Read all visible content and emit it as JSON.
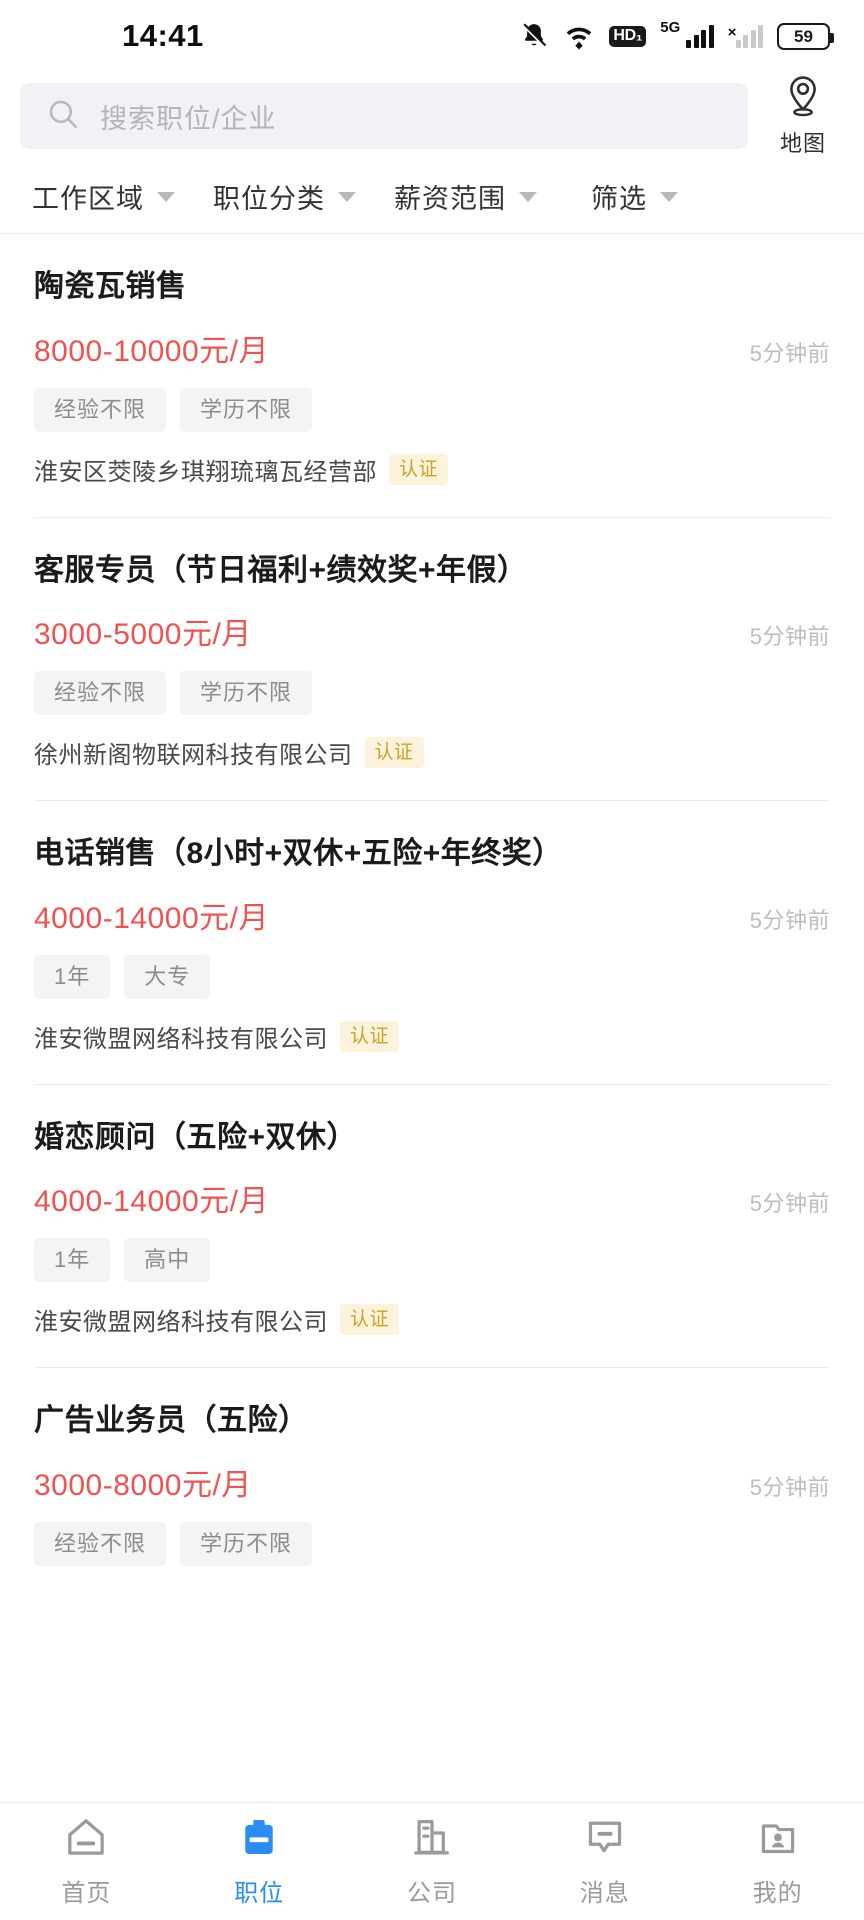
{
  "status_bar": {
    "time": "14:41",
    "battery_percent": "59",
    "network_type": "5G",
    "icons": [
      "bell-muted-icon",
      "wifi-icon",
      "hd-icon",
      "signal-5g-icon",
      "signal-secondary-icon",
      "battery-icon"
    ]
  },
  "search": {
    "placeholder": "搜索职位/企业",
    "icon": "search-icon",
    "map_button": {
      "label": "地图",
      "icon": "map-pin-icon"
    }
  },
  "filters": [
    {
      "label": "工作区域",
      "icon": "chevron-down-icon"
    },
    {
      "label": "职位分类",
      "icon": "chevron-down-icon"
    },
    {
      "label": "薪资范围",
      "icon": "chevron-down-icon"
    },
    {
      "label": "筛选",
      "icon": "chevron-down-icon"
    }
  ],
  "jobs": [
    {
      "title": "陶瓷瓦销售",
      "salary": "8000-10000元/月",
      "posted": "5分钟前",
      "tags": [
        "经验不限",
        "学历不限"
      ],
      "company": "淮安区茭陵乡琪翔琉璃瓦经营部",
      "badge": "认证"
    },
    {
      "title": "客服专员（节日福利+绩效奖+年假）",
      "salary": "3000-5000元/月",
      "posted": "5分钟前",
      "tags": [
        "经验不限",
        "学历不限"
      ],
      "company": "徐州新阁物联网科技有限公司",
      "badge": "认证"
    },
    {
      "title": "电话销售（8小时+双休+五险+年终奖）",
      "salary": "4000-14000元/月",
      "posted": "5分钟前",
      "tags": [
        "1年",
        "大专"
      ],
      "company": "淮安微盟网络科技有限公司",
      "badge": "认证"
    },
    {
      "title": "婚恋顾问（五险+双休）",
      "salary": "4000-14000元/月",
      "posted": "5分钟前",
      "tags": [
        "1年",
        "高中"
      ],
      "company": "淮安微盟网络科技有限公司",
      "badge": "认证"
    },
    {
      "title": "广告业务员（五险）",
      "salary": "3000-8000元/月",
      "posted": "5分钟前",
      "tags": [
        "经验不限",
        "学历不限"
      ],
      "company": "",
      "badge": ""
    }
  ],
  "tabbar": {
    "active_index": 1,
    "items": [
      {
        "label": "首页",
        "icon": "home-icon"
      },
      {
        "label": "职位",
        "icon": "briefcase-icon"
      },
      {
        "label": "公司",
        "icon": "building-icon"
      },
      {
        "label": "消息",
        "icon": "message-icon"
      },
      {
        "label": "我的",
        "icon": "profile-icon"
      }
    ]
  },
  "colors": {
    "accent": "#2a8cf5",
    "salary": "#f2524f",
    "badge_bg": "#fdf3dc",
    "badge_text": "#c9a227",
    "search_bg": "#f1f2f6"
  }
}
